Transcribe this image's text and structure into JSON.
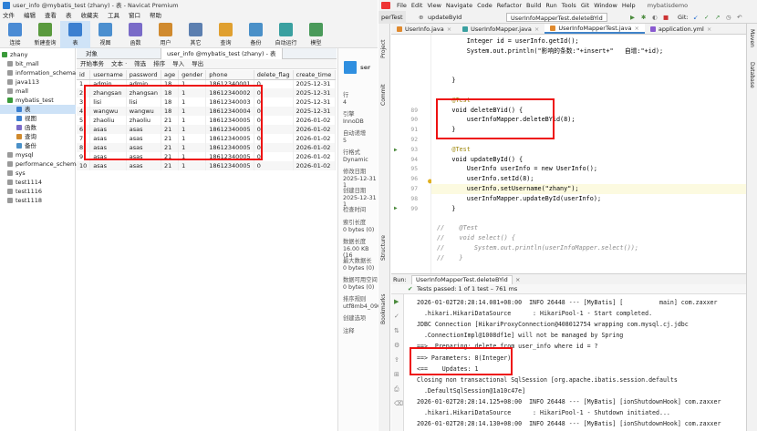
{
  "navicat": {
    "title": "user_info @mybatis_test (zhany) - 表 - Navicat Premium",
    "menu": [
      "文件",
      "编辑",
      "查看",
      "表",
      "收藏夹",
      "工具",
      "窗口",
      "帮助"
    ],
    "toolbar": [
      "连接",
      "新建查询",
      "表",
      "视图",
      "函数",
      "用户",
      "其它",
      "查询",
      "备份",
      "自动运行",
      "模型"
    ],
    "tree": {
      "root": "zhany",
      "items": [
        "bit_mall",
        "information_schema",
        "java113",
        "mall",
        "mybatis_test"
      ],
      "mybatis_children": [
        "表",
        "视图",
        "函数",
        "查询",
        "备份"
      ],
      "after": [
        "mysql",
        "performance_schema",
        "sys",
        "test1114",
        "test1116",
        "test1118"
      ]
    },
    "tab_object": "对象",
    "tab_title": "user_info @mybatis_test (zhany) - 表",
    "subtoolbar": [
      "开始事务",
      "文本 ·",
      "筛选",
      "排序",
      "导入",
      "导出"
    ],
    "table": {
      "columns": [
        "id",
        "username",
        "password",
        "age",
        "gender",
        "phone",
        "delete_flag",
        "create_time"
      ],
      "rows": [
        [
          "1",
          "admin",
          "admin",
          "18",
          "1",
          "18612340001",
          "0",
          "2025-12-31"
        ],
        [
          "2",
          "zhangsan",
          "zhangsan",
          "18",
          "1",
          "18612340002",
          "0",
          "2025-12-31"
        ],
        [
          "3",
          "lisi",
          "lisi",
          "18",
          "1",
          "18612340003",
          "0",
          "2025-12-31"
        ],
        [
          "4",
          "wangwu",
          "wangwu",
          "18",
          "1",
          "18612340004",
          "0",
          "2025-12-31"
        ],
        [
          "5",
          "zhaoliu",
          "zhaoliu",
          "21",
          "1",
          "18612340005",
          "0",
          "2026-01-02"
        ],
        [
          "6",
          "asas",
          "asas",
          "21",
          "1",
          "18612340005",
          "0",
          "2026-01-02"
        ],
        [
          "7",
          "asas",
          "asas",
          "21",
          "1",
          "18612340005",
          "0",
          "2026-01-02"
        ],
        [
          "8",
          "asas",
          "asas",
          "21",
          "1",
          "18612340005",
          "0",
          "2026-01-02"
        ],
        [
          "9",
          "asas",
          "asas",
          "21",
          "1",
          "18612340005",
          "0",
          "2026-01-02"
        ],
        [
          "10",
          "asas",
          "asas",
          "21",
          "1",
          "18612340005",
          "0",
          "2026-01-02"
        ]
      ]
    },
    "info": [
      [
        "use",
        "ser"
      ],
      [
        "行",
        "4"
      ],
      [
        "引擎",
        "InnoDB"
      ],
      [
        "自动递增",
        "5"
      ],
      [
        "行格式",
        "Dynamic"
      ],
      [
        "修改日期",
        "2025-12-31 1"
      ],
      [
        "创建日期",
        "2025-12-31 1"
      ],
      [
        "检查时间",
        ""
      ],
      [
        "索引长度",
        "0 bytes (0)"
      ],
      [
        "数据长度",
        "16.00 KB (16"
      ],
      [
        "最大数据长",
        "0 bytes (0)"
      ],
      [
        "数据可用空间",
        "0 bytes (0)"
      ],
      [
        "排序规则",
        "utf8mb4_090"
      ],
      [
        "创建选项",
        ""
      ],
      [
        "注释",
        ""
      ]
    ]
  },
  "ide": {
    "menu": [
      "File",
      "Edit",
      "View",
      "Navigate",
      "Code",
      "Refactor",
      "Build",
      "Run",
      "Tools",
      "Git",
      "Window",
      "Help",
      "mybatisdemo"
    ],
    "nav": {
      "left": "perTest",
      "crumb": "updateById",
      "config": "UserInfoMapperTest.deleteBYid",
      "git": "Git:"
    },
    "tabs": [
      "UserInfo.java",
      "UserInfoMapper.java",
      "UserInfoMapperTest.java",
      "application.yml"
    ],
    "left_tools": [
      "Project",
      "Commit",
      "Structure",
      "Bookmarks"
    ],
    "right_tools": [
      "Maven",
      "Database"
    ],
    "code_lines": [
      {
        "n": "",
        "t": "        Integer id = userInfo.getId();"
      },
      {
        "n": "",
        "t": "        System.out.println(\"影响的条数:\"+insert+\"   自增:\"+id);"
      },
      {
        "n": "",
        "t": ""
      },
      {
        "n": "",
        "t": ""
      },
      {
        "n": "",
        "t": "    }"
      },
      {
        "n": "",
        "t": ""
      },
      {
        "n": "",
        "t": "    @Test"
      },
      {
        "n": "89",
        "t": "    void deleteBYid() {"
      },
      {
        "n": "90",
        "t": "        userInfoMapper.deleteBYid(8);"
      },
      {
        "n": "91",
        "t": "    }"
      },
      {
        "n": "92",
        "t": ""
      },
      {
        "n": "93",
        "t": "    @Test"
      },
      {
        "n": "94",
        "t": "    void updateById() {"
      },
      {
        "n": "95",
        "t": "        UserInfo userInfo = new UserInfo();"
      },
      {
        "n": "96",
        "t": "        userInfo.setId(8);"
      },
      {
        "n": "97",
        "t": "        userInfo.setUsername(\"zhany\");"
      },
      {
        "n": "98",
        "t": "        userInfoMapper.updateById(userInfo);"
      },
      {
        "n": "99",
        "t": "    }"
      },
      {
        "n": "",
        "t": ""
      },
      {
        "n": "",
        "t": "//    @Test"
      },
      {
        "n": "",
        "t": "//    void select() {"
      },
      {
        "n": "",
        "t": "//        System.out.println(userInfoMapper.select());"
      },
      {
        "n": "",
        "t": "//    }"
      }
    ],
    "run_title": "UserInfoMapperTest.deleteBYid",
    "run_label": "Run:",
    "test_status": "Tests passed: 1 of 1 test – 761 ms",
    "console": [
      "2026-01-02T20:28:14.081+08:00  INFO 26448 --- [MyBatis] [          main] com.zaxxer",
      "  .hikari.HikariDataSource      : HikariPool-1 - Start completed.",
      "JDBC Connection [HikariProxyConnection@408012754 wrapping com.mysql.cj.jdbc",
      "  .ConnectionImpl@1008df1e] will not be managed by Spring",
      "==>  Preparing: delete from user_info where id = ?",
      "==> Parameters: 8(Integer)",
      "<==    Updates: 1",
      "Closing non transactional SqlSession [org.apache.ibatis.session.defaults",
      "  .DefaultSqlSession@1a10c47e]",
      "2026-01-02T20:28:14.125+08:00  INFO 26448 --- [MyBatis] [ionShutdownHook] com.zaxxer",
      "  .hikari.HikariDataSource      : HikariPool-1 - Shutdown initiated...",
      "2026-01-02T20:28:14.130+08:00  INFO 26448 --- [MyBatis] [ionShutdownHook] com.zaxxer",
      "  .hikari.HikariDataSource      : HikariPool-1 - Shutdown completed."
    ]
  }
}
